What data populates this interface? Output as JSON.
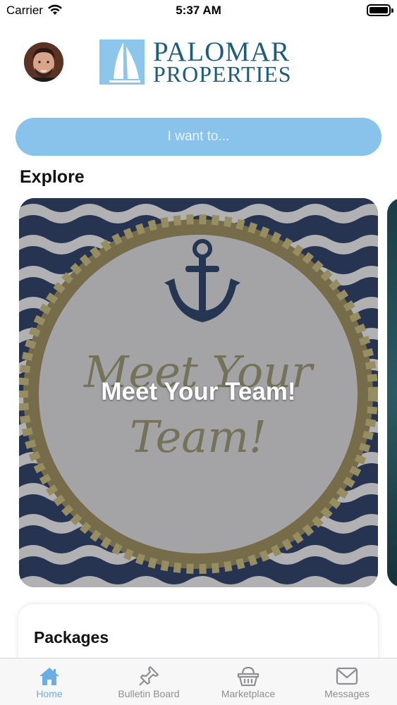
{
  "status_bar": {
    "carrier": "Carrier",
    "time": "5:37 AM",
    "battery_level": 1.0
  },
  "header": {
    "avatar_icon": "user-avatar",
    "logo": {
      "line1": "PALOMAR",
      "line2": "PROPERTIES",
      "color": "#1d5c7a",
      "mark_color": "#8cc6ea"
    }
  },
  "want_button": {
    "label": "I want to...",
    "color": "#89c2ea"
  },
  "explore": {
    "title": "Explore",
    "cards": [
      {
        "title": "Meet Your Team!"
      }
    ]
  },
  "packages": {
    "title": "Packages"
  },
  "tab_bar": {
    "active_color": "#6aaee5",
    "inactive_color": "#8e8e93",
    "tabs": [
      {
        "label": "Home",
        "icon": "home-icon",
        "active": true
      },
      {
        "label": "Bulletin Board",
        "icon": "pushpin-icon",
        "active": false
      },
      {
        "label": "Marketplace",
        "icon": "basket-icon",
        "active": false
      },
      {
        "label": "Messages",
        "icon": "envelope-icon",
        "active": false
      }
    ]
  }
}
